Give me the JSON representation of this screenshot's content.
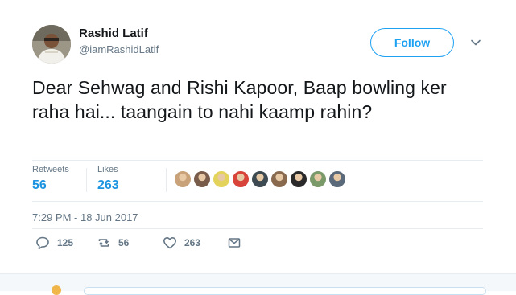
{
  "author": {
    "display_name": "Rashid Latif",
    "handle": "@iamRashidLatif",
    "avatar_icon": "profile-photo"
  },
  "follow_button": {
    "label": "Follow"
  },
  "menu": {
    "icon": "chevron-down-icon"
  },
  "tweet": {
    "text": "Dear Sehwag and Rishi Kapoor, Baap bowling ker raha hai... taangain to nahi kaamp rahin?",
    "timestamp": "7:29 PM - 18 Jun 2017"
  },
  "stats": {
    "retweets_label": "Retweets",
    "retweets_value": "56",
    "likes_label": "Likes",
    "likes_value": "263"
  },
  "liker_avatars": [
    {
      "color": "#c9a27a"
    },
    {
      "color": "#7a5c4a"
    },
    {
      "color": "#e3d35a"
    },
    {
      "color": "#d8433a"
    },
    {
      "color": "#3d4a52"
    },
    {
      "color": "#8a6a4e"
    },
    {
      "color": "#2a2a2a"
    },
    {
      "color": "#7a9a6a"
    },
    {
      "color": "#5a6a7a"
    }
  ],
  "actions": {
    "reply_count": "125",
    "retweet_count": "56",
    "like_count": "263"
  },
  "colors": {
    "accent": "#1da1f2",
    "muted": "#657786",
    "stat_value": "#1c94e0"
  }
}
